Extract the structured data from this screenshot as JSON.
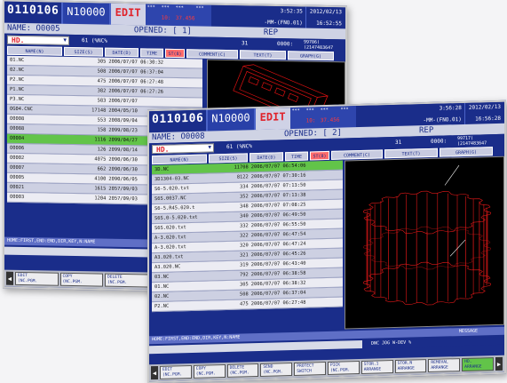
{
  "back": {
    "program": "0110106",
    "sequence": "N10000",
    "mode": "EDIT",
    "status": {
      "r1": [
        "***",
        "***",
        "***",
        "***"
      ],
      "r2": [
        "",
        "10:",
        "37.456",
        ""
      ]
    },
    "clock": {
      "time": "3:52:35",
      "date": "2012/02/13",
      "line2": "-MM-(FNO.01)",
      "time2": "16:52:55"
    },
    "name": "NAME: O0005",
    "opened": "OPENED: [ 1]",
    "rep": "REP",
    "extension": "HD.",
    "filter_text": "61  (%NC%",
    "count": "31",
    "bytes": "0000:",
    "free": "99706(",
    "free2": "(2147483647",
    "headers": [
      "NAME(N)",
      "SIZE(S)",
      "DATE(D)",
      "TIME",
      "ST(8)",
      "COMMENT(C)",
      "TEXT(T)",
      "GRAPH(G)"
    ],
    "files": [
      {
        "name": "01.NC",
        "size": "305",
        "date": "2006/07/07 06:30:32"
      },
      {
        "name": "02.NC",
        "size": "508",
        "date": "2006/07/07 06:37:04"
      },
      {
        "name": "P2.NC",
        "size": "475",
        "date": "2006/07/07 06:27:48"
      },
      {
        "name": "P1.NC",
        "size": "382",
        "date": "2006/07/07 06:27:26"
      },
      {
        "name": "P3.NC",
        "size": "583",
        "date": "2006/07/07"
      },
      {
        "name": "OG04.CNC",
        "size": "17148",
        "date": "2004/05/10"
      },
      {
        "name": "O0008",
        "size": "553",
        "date": "2008/09/04"
      },
      {
        "name": "O0088",
        "size": "158",
        "date": "2099/08/23"
      },
      {
        "name": "O0004",
        "size": "1116",
        "date": "2099/04/27"
      },
      {
        "name": "O0006",
        "size": "126",
        "date": "2099/08/14"
      },
      {
        "name": "O0002",
        "size": "4075",
        "date": "2090/06/30"
      },
      {
        "name": "O0007",
        "size": "662",
        "date": "2090/06/30"
      },
      {
        "name": "O0005",
        "size": "4100",
        "date": "2090/06/05"
      },
      {
        "name": "O0021",
        "size": "1615",
        "date": "2057/09/03"
      },
      {
        "name": "O0003",
        "size": "1204",
        "date": "2057/09/03"
      }
    ],
    "selected_index": 8,
    "help": "HOME:FIRST,END:END,DIR,KEY,N:NAME",
    "softkeys": [
      [
        "EDIT",
        "(NC.PGM."
      ],
      [
        "COPY",
        "(NC.PGM."
      ],
      [
        "DELETE",
        "(NC.PGM."
      ],
      [
        "SEND",
        "(NC.PGM."
      ]
    ]
  },
  "front": {
    "program": "0110106",
    "sequence": "N10000",
    "mode": "EDIT",
    "status": {
      "r1": [
        "***",
        "***",
        "***",
        "***"
      ],
      "r2": [
        "",
        "10:",
        "37.456",
        ""
      ]
    },
    "clock": {
      "time": "3:56:28",
      "date": "2012/02/13",
      "line2": "-MM-(FNO.01)",
      "time2": "16:56:28"
    },
    "name": "NAME: O0008",
    "opened": "OPENED: [ 2]",
    "rep": "REP",
    "extension": "HD.",
    "filter_text": "61  (%NC%",
    "count": "31",
    "bytes": "0000:",
    "free": "99717(",
    "free2": "(2147483647",
    "headers": [
      "NAME(N)",
      "SIZE(S)",
      "DATE(D)",
      "TIME",
      "ST(8)",
      "COMMENT(C)",
      "TEXT(T)",
      "GRAPH(G)"
    ],
    "files": [
      {
        "name": "3D.NC",
        "size": "11708",
        "date": "2006/07/07 06:54:06"
      },
      {
        "name": "3D1304-03.NC",
        "size": "8122",
        "date": "2006/07/07 07:30:16"
      },
      {
        "name": "S6-5.020.txt",
        "size": "334",
        "date": "2006/07/07 07:13:50"
      },
      {
        "name": "S6S.0037.NC",
        "size": "352",
        "date": "2006/07/07 07:13:38"
      },
      {
        "name": "S6-5.R45.020.t",
        "size": "348",
        "date": "2006/07/07 07:08:25"
      },
      {
        "name": "S6S.0-5.020.txt",
        "size": "340",
        "date": "2006/07/07 06:49:50"
      },
      {
        "name": "S6S.020.txt",
        "size": "332",
        "date": "2006/07/07 06:55:50"
      },
      {
        "name": "A-3.020.txt",
        "size": "322",
        "date": "2006/07/07 06:47:54"
      },
      {
        "name": "A-3.020.txt",
        "size": "320",
        "date": "2006/07/07 06:47:24"
      },
      {
        "name": "A3.020.txt",
        "size": "321",
        "date": "2006/07/07 06:45:26"
      },
      {
        "name": "A3.020.NC",
        "size": "319",
        "date": "2006/07/07 06:43:40"
      },
      {
        "name": "03.NC",
        "size": "792",
        "date": "2006/07/07 06:38:58"
      },
      {
        "name": "01.NC",
        "size": "305",
        "date": "2006/07/07 06:38:32"
      },
      {
        "name": "02.NC",
        "size": "508",
        "date": "2006/07/07 06:37:04"
      },
      {
        "name": "P2.NC",
        "size": "475",
        "date": "2006/07/07 06:27:48"
      }
    ],
    "selected_index": 0,
    "help": "HOME:FIRST,END:END,DIR,KEY,N:NAME",
    "message": "MESSAGE",
    "msg_line": "DNC  JOG W-DEV %",
    "softkeys": [
      [
        "EDIT",
        "(NC.PGM."
      ],
      [
        "COPY",
        "(NC.PGM."
      ],
      [
        "DELETE",
        "(NC.PGM."
      ],
      [
        "SEND",
        "(NC.PGM."
      ],
      [
        "PROTECT",
        "SWITCH"
      ],
      [
        "PICK",
        "(NC.PGM."
      ],
      [
        "STOR.1",
        "ARRANGE"
      ],
      [
        "STOR.N",
        "ARRANGE"
      ],
      [
        "REMOVAL",
        "ARRANGE"
      ],
      [
        "HD.",
        "ARRANGE"
      ]
    ],
    "active_softkey": 9
  }
}
